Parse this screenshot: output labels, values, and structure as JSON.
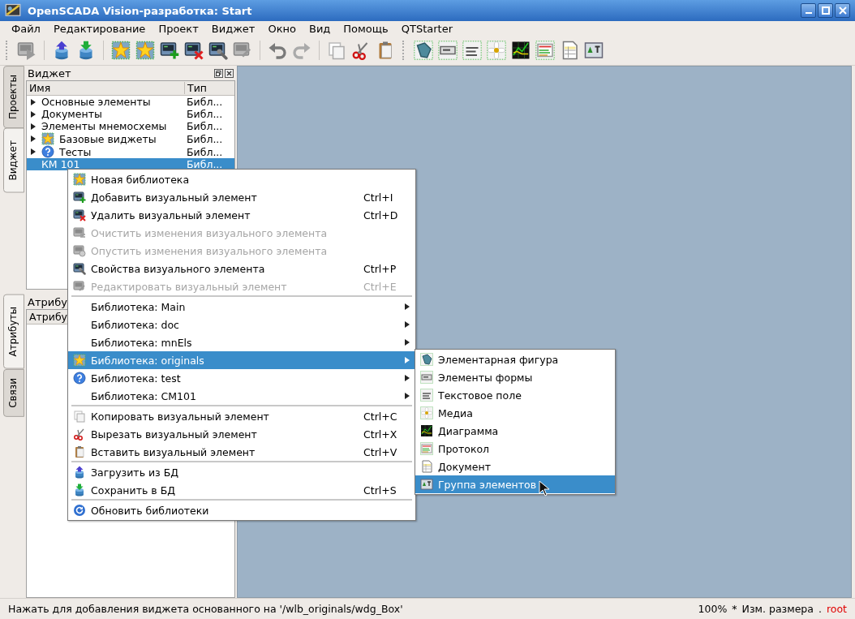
{
  "window": {
    "title": "OpenSCADA Vision-разработка: Start"
  },
  "menubar": [
    "Файл",
    "Редактирование",
    "Проект",
    "Виджет",
    "Окно",
    "Вид",
    "Помощь",
    "QTStarter"
  ],
  "side_tabs_top": [
    {
      "label": "Проекты",
      "selected": false
    },
    {
      "label": "Виджет",
      "selected": true
    }
  ],
  "widget_dock": {
    "title": "Виджет",
    "columns": [
      "Имя",
      "Тип"
    ],
    "rows": [
      {
        "name": "Основные элементы",
        "type": "Библ...",
        "expandable": true,
        "selected": false
      },
      {
        "name": "Документы",
        "type": "Библ...",
        "expandable": true,
        "selected": false
      },
      {
        "name": "Элементы мнемосхемы",
        "type": "Библ...",
        "expandable": true,
        "selected": false
      },
      {
        "name": "Базовые виджеты",
        "type": "Библ...",
        "expandable": true,
        "selected": false
      },
      {
        "name": "Тесты",
        "type": "Библ...",
        "expandable": true,
        "selected": false
      },
      {
        "name": "КМ 101",
        "type": "Библ...",
        "expandable": false,
        "selected": true
      }
    ]
  },
  "side_tabs_bottom": [
    {
      "label": "Атрибуты",
      "selected": true
    },
    {
      "label": "Связи",
      "selected": false
    }
  ],
  "attributes_dock": {
    "title": "Атрибу",
    "columns": [
      "Атрибу"
    ]
  },
  "context_menu": [
    {
      "kind": "item",
      "label": "Новая библиотека",
      "disabled": false,
      "selected": false,
      "has_submenu": false
    },
    {
      "kind": "item",
      "label": "Добавить визуальный элемент",
      "shortcut": "Ctrl+I",
      "disabled": false,
      "selected": false,
      "has_submenu": false
    },
    {
      "kind": "item",
      "label": "Удалить визуальный элемент",
      "shortcut": "Ctrl+D",
      "disabled": false,
      "selected": false,
      "has_submenu": false
    },
    {
      "kind": "item",
      "label": "Очистить изменения визуального элемента",
      "disabled": true,
      "selected": false,
      "has_submenu": false
    },
    {
      "kind": "item",
      "label": "Опустить изменения визуального элемента",
      "disabled": true,
      "selected": false,
      "has_submenu": false
    },
    {
      "kind": "item",
      "label": "Свойства визуального элемента",
      "shortcut": "Ctrl+P",
      "disabled": false,
      "selected": false,
      "has_submenu": false
    },
    {
      "kind": "item",
      "label": "Редактировать визуальный элемент",
      "shortcut": "Ctrl+E",
      "disabled": true,
      "selected": false,
      "has_submenu": false
    },
    {
      "kind": "separator"
    },
    {
      "kind": "item",
      "label": "Библиотека: Main",
      "disabled": false,
      "selected": false,
      "has_submenu": true
    },
    {
      "kind": "item",
      "label": "Библиотека: doc",
      "disabled": false,
      "selected": false,
      "has_submenu": true
    },
    {
      "kind": "item",
      "label": "Библиотека: mnEls",
      "disabled": false,
      "selected": false,
      "has_submenu": true
    },
    {
      "kind": "item",
      "label": "Библиотека: originals",
      "disabled": false,
      "selected": true,
      "has_submenu": true
    },
    {
      "kind": "item",
      "label": "Библиотека: test",
      "disabled": false,
      "selected": false,
      "has_submenu": true
    },
    {
      "kind": "item",
      "label": "Библиотека: CM101",
      "disabled": false,
      "selected": false,
      "has_submenu": true
    },
    {
      "kind": "separator"
    },
    {
      "kind": "item",
      "label": "Копировать визуальный элемент",
      "shortcut": "Ctrl+C",
      "disabled": false,
      "selected": false,
      "has_submenu": false
    },
    {
      "kind": "item",
      "label": "Вырезать визуальный элемент",
      "shortcut": "Ctrl+X",
      "disabled": false,
      "selected": false,
      "has_submenu": false
    },
    {
      "kind": "item",
      "label": "Вставить визуальный элемент",
      "shortcut": "Ctrl+V",
      "disabled": false,
      "selected": false,
      "has_submenu": false
    },
    {
      "kind": "separator"
    },
    {
      "kind": "item",
      "label": "Загрузить из БД",
      "disabled": false,
      "selected": false,
      "has_submenu": false
    },
    {
      "kind": "item",
      "label": "Сохранить в БД",
      "shortcut": "Ctrl+S",
      "disabled": false,
      "selected": false,
      "has_submenu": false
    },
    {
      "kind": "separator"
    },
    {
      "kind": "item",
      "label": "Обновить библиотеки",
      "disabled": false,
      "selected": false,
      "has_submenu": false
    }
  ],
  "submenu": [
    {
      "kind": "item",
      "label": "Элементарная фигура",
      "disabled": false,
      "selected": false,
      "has_submenu": false
    },
    {
      "kind": "item",
      "label": "Элементы формы",
      "disabled": false,
      "selected": false,
      "has_submenu": false
    },
    {
      "kind": "item",
      "label": "Текстовое поле",
      "disabled": false,
      "selected": false,
      "has_submenu": false
    },
    {
      "kind": "item",
      "label": "Медиа",
      "disabled": false,
      "selected": false,
      "has_submenu": false
    },
    {
      "kind": "item",
      "label": "Диаграмма",
      "disabled": false,
      "selected": false,
      "has_submenu": false
    },
    {
      "kind": "item",
      "label": "Протокол",
      "disabled": false,
      "selected": false,
      "has_submenu": false
    },
    {
      "kind": "item",
      "label": "Документ",
      "disabled": false,
      "selected": false,
      "has_submenu": false
    },
    {
      "kind": "item",
      "label": "Группа элементов",
      "disabled": false,
      "selected": true,
      "has_submenu": false
    }
  ],
  "status_bar": {
    "message": "Нажать для добавления виджета основанного на '/wlb_originals/wdg_Box'",
    "zoom": "100%",
    "modified": "*",
    "mode": "Изм. размера",
    "separator": ".",
    "user": "root"
  }
}
